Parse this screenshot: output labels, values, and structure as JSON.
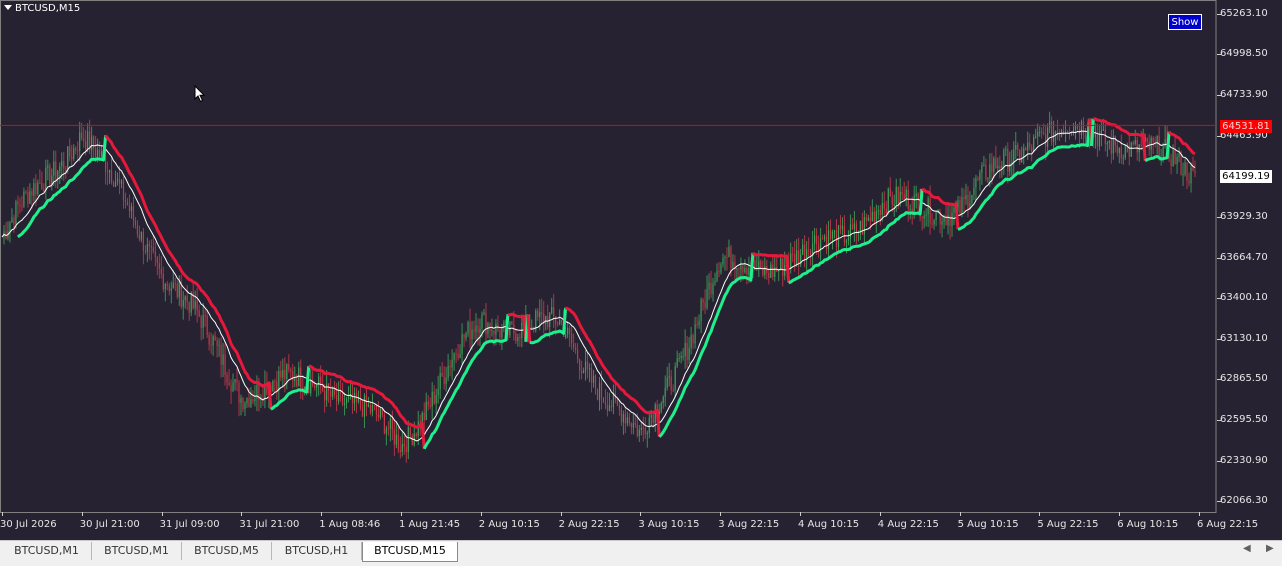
{
  "chart": {
    "symbol": "BTCUSD,M15",
    "show_button": "Show",
    "current_price": "64199.19",
    "marker_price": "64531.81"
  },
  "price_axis": {
    "labels": [
      "65263.10",
      "64998.50",
      "64733.90",
      "64463.90",
      "63929.30",
      "63664.70",
      "63400.10",
      "63130.10",
      "62865.50",
      "62595.50",
      "62330.90",
      "62066.30"
    ]
  },
  "time_axis": {
    "labels": [
      "30 Jul 2026",
      "30 Jul 21:00",
      "31 Jul 09:00",
      "31 Jul 21:00",
      "1 Aug 08:46",
      "1 Aug 21:45",
      "2 Aug 10:15",
      "2 Aug 22:15",
      "3 Aug 10:15",
      "3 Aug 22:15",
      "4 Aug 10:15",
      "4 Aug 22:15",
      "5 Aug 10:15",
      "5 Aug 22:15",
      "6 Aug 10:15",
      "6 Aug 22:15"
    ]
  },
  "tabs": [
    {
      "label": "BTCUSD,M1",
      "active": false
    },
    {
      "label": "BTCUSD,M1",
      "active": false
    },
    {
      "label": "BTCUSD,M5",
      "active": false
    },
    {
      "label": "BTCUSD,H1",
      "active": false
    },
    {
      "label": "BTCUSD,M15",
      "active": true
    }
  ],
  "colors": {
    "background": "#262231",
    "bull_candle": "#3fa35a",
    "bear_candle": "#c8384a",
    "trend_up": "#1ef08c",
    "trend_down": "#e8183c",
    "baseline": "#ffffff",
    "marker_line": "#d01010"
  },
  "chart_data": {
    "type": "candlestick",
    "symbol": "BTCUSD",
    "timeframe": "M15",
    "ylim": [
      62000,
      65300
    ],
    "close_trace": [
      {
        "t": "30 Jul 2026",
        "price": 63800
      },
      {
        "t": "30 Jul 21:00",
        "price": 64500
      },
      {
        "t": "31 Jul 09:00",
        "price": 63600
      },
      {
        "t": "31 Jul 21:00",
        "price": 62800
      },
      {
        "t": "1 Aug 08:46",
        "price": 62860
      },
      {
        "t": "1 Aug 21:45",
        "price": 62450
      },
      {
        "t": "2 Aug 10:15",
        "price": 63250
      },
      {
        "t": "2 Aug 22:15",
        "price": 63200
      },
      {
        "t": "3 Aug 10:15",
        "price": 62450
      },
      {
        "t": "3 Aug 22:15",
        "price": 63600
      },
      {
        "t": "4 Aug 10:15",
        "price": 63650
      },
      {
        "t": "4 Aug 22:15",
        "price": 64000
      },
      {
        "t": "5 Aug 10:15",
        "price": 64000
      },
      {
        "t": "5 Aug 22:15",
        "price": 64500
      },
      {
        "t": "6 Aug 10:15",
        "price": 64450
      },
      {
        "t": "6 Aug 22:15",
        "price": 64199.19
      }
    ],
    "marker_line_price": 64531.81,
    "current_price": 64199.19
  }
}
